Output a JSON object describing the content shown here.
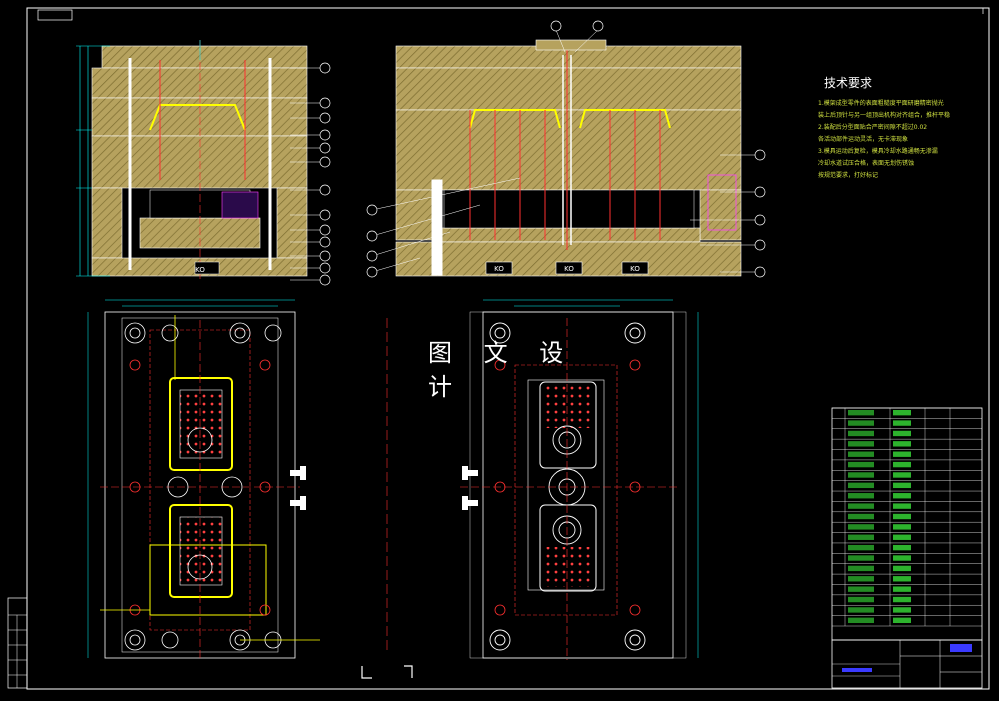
{
  "overlay_title": "图 文 设 计",
  "tech": {
    "title": "技术要求",
    "lines": [
      "1.模架成型零件的表面粗糙度平面研磨精密抛光",
      "装上后顶针与另一组顶出机构对齐组合，推杆平稳",
      "2.装配后分型面贴合严密间隙不超过0.02",
      "各活动部件运动灵活，无卡滞现象",
      "3.模具运动后复检，模具冷却水路通畅无渗漏",
      "冷却水道试压合格，表面无划伤锈蚀",
      "按规范要求，打好标记"
    ]
  },
  "parts_count": 21,
  "block_labels": [
    "KO",
    "KO",
    "KO",
    "KO"
  ],
  "colors": {
    "background": "#000000",
    "frame": "#ffffff",
    "mold_fill": "#c8b070",
    "hatch": "#8a7a3a",
    "cavity_line": "#ffff00",
    "dim_line": "#00ffff",
    "center_line": "#ff3030",
    "green_text": "#40ff40",
    "magenta": "#ff40ff"
  }
}
